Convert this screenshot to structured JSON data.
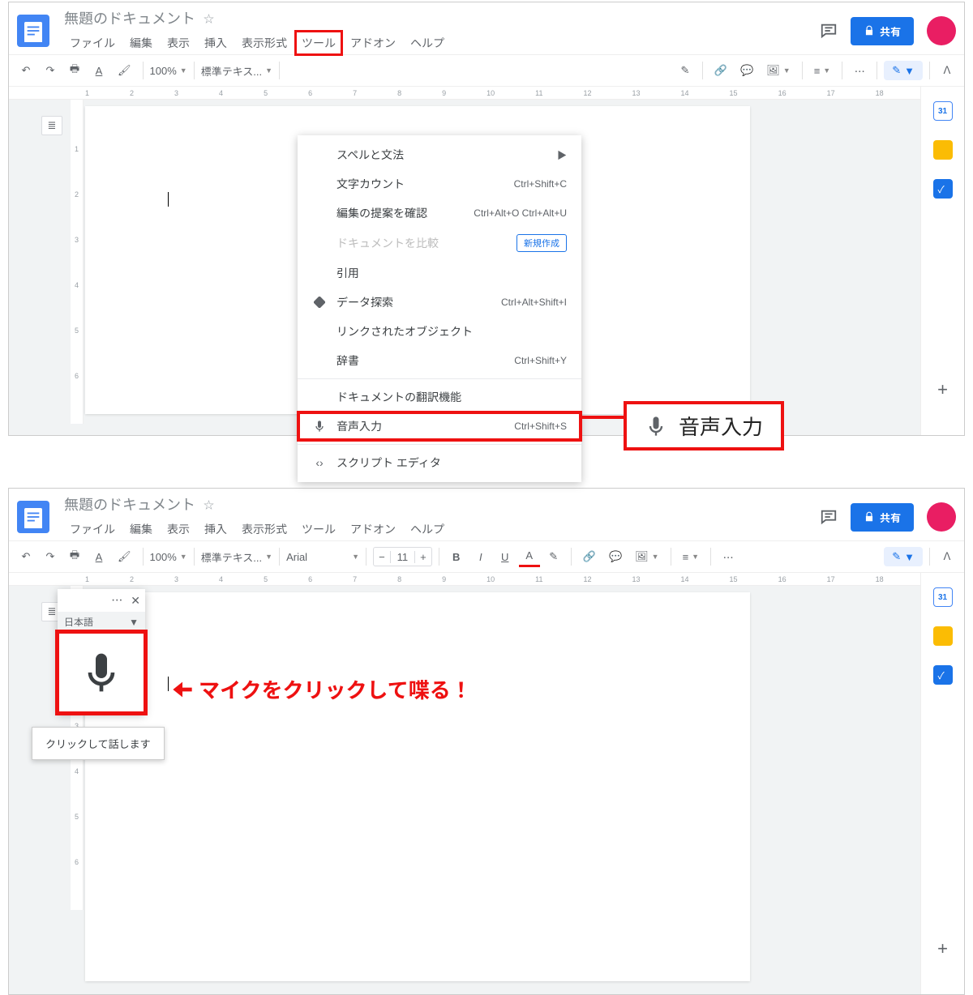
{
  "doc": {
    "title": "無題のドキュメント"
  },
  "menubar": [
    "ファイル",
    "編集",
    "表示",
    "挿入",
    "表示形式",
    "ツール",
    "アドオン",
    "ヘルプ"
  ],
  "active_menu": "ツール",
  "share": "共有",
  "toolbar": {
    "zoom": "100%",
    "style": "標準テキス...",
    "font": "Arial",
    "fontsize": "11"
  },
  "sidepanel": {
    "calendar_day": "31"
  },
  "dropdown": [
    {
      "label": "スペルと文法",
      "shortcut": "▶",
      "icon": ""
    },
    {
      "label": "文字カウント",
      "shortcut": "Ctrl+Shift+C",
      "icon": ""
    },
    {
      "label": "編集の提案を確認",
      "shortcut": "Ctrl+Alt+O Ctrl+Alt+U",
      "icon": ""
    },
    {
      "label": "ドキュメントを比較",
      "shortcut": "",
      "badge": "新規作成",
      "disabled": true,
      "icon": ""
    },
    {
      "label": "引用",
      "shortcut": "",
      "icon": ""
    },
    {
      "label": "データ探索",
      "shortcut": "Ctrl+Alt+Shift+I",
      "icon": "◆"
    },
    {
      "label": "リンクされたオブジェクト",
      "shortcut": "",
      "icon": ""
    },
    {
      "label": "辞書",
      "shortcut": "Ctrl+Shift+Y",
      "icon": ""
    },
    {
      "hr": true
    },
    {
      "label": "ドキュメントの翻訳機能",
      "shortcut": "",
      "icon": ""
    },
    {
      "label": "音声入力",
      "shortcut": "Ctrl+Shift+S",
      "icon": "🎤",
      "highlight": true
    },
    {
      "hr": true
    },
    {
      "label": "スクリプト エディタ",
      "shortcut": "",
      "icon": "<>"
    }
  ],
  "callout": "音声入力",
  "voice": {
    "lang": "日本語",
    "tooltip": "クリックして話します"
  },
  "instruction": "マイクをクリックして喋る！",
  "ruler_top": [
    "1",
    "2",
    "3",
    "4",
    "5",
    "6",
    "7",
    "8",
    "9",
    "10",
    "11",
    "12",
    "13",
    "14",
    "15",
    "16",
    "17",
    "18"
  ],
  "ruler_left": [
    "",
    "1",
    "2",
    "3",
    "4",
    "5",
    "6"
  ]
}
